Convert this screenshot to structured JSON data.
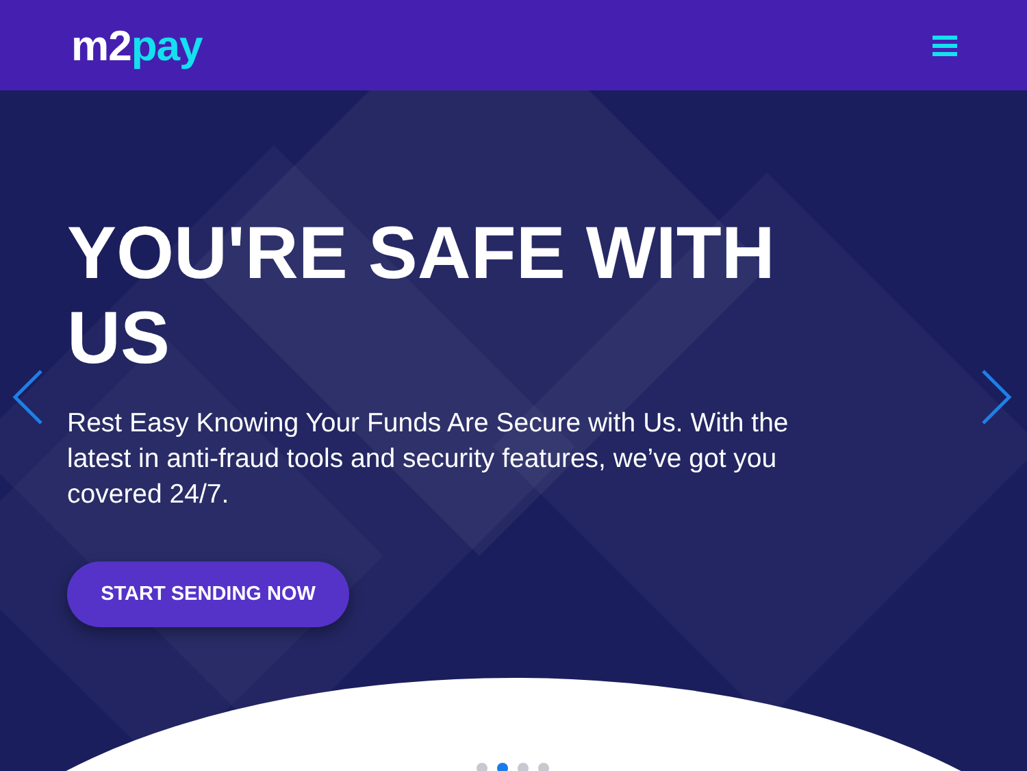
{
  "header": {
    "logo": {
      "primary": "m2",
      "accent": "pay"
    }
  },
  "hero": {
    "title": "YOU'RE SAFE WITH US",
    "text": "Rest Easy Knowing Your Funds Are Secure with Us. With the latest in anti-fraud tools and security features, we’ve got you covered 24/7.",
    "button": "START SENDING NOW"
  },
  "slides": [
    {
      "selected": false
    },
    {
      "selected": true
    },
    {
      "selected": false
    },
    {
      "selected": false
    }
  ]
}
